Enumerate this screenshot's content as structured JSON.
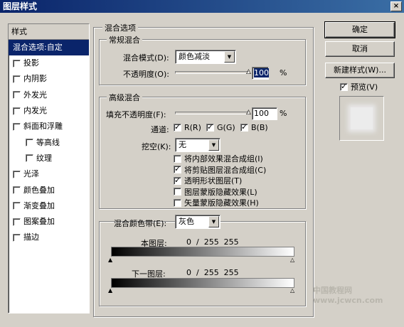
{
  "window": {
    "title": "图层样式",
    "close_glyph": "×"
  },
  "styles_panel": {
    "header": "样式",
    "items": [
      {
        "label": "混合选项:自定",
        "checkbox": false,
        "selected": true,
        "indent": false
      },
      {
        "label": "投影",
        "checkbox": true,
        "checked": false,
        "indent": false
      },
      {
        "label": "内阴影",
        "checkbox": true,
        "checked": false,
        "indent": false
      },
      {
        "label": "外发光",
        "checkbox": true,
        "checked": false,
        "indent": false
      },
      {
        "label": "内发光",
        "checkbox": true,
        "checked": false,
        "indent": false
      },
      {
        "label": "斜面和浮雕",
        "checkbox": true,
        "checked": false,
        "indent": false
      },
      {
        "label": "等高线",
        "checkbox": true,
        "checked": false,
        "indent": true
      },
      {
        "label": "纹理",
        "checkbox": true,
        "checked": false,
        "indent": true
      },
      {
        "label": "光泽",
        "checkbox": true,
        "checked": false,
        "indent": false
      },
      {
        "label": "颜色叠加",
        "checkbox": true,
        "checked": false,
        "indent": false
      },
      {
        "label": "渐变叠加",
        "checkbox": true,
        "checked": false,
        "indent": false
      },
      {
        "label": "图案叠加",
        "checkbox": true,
        "checked": false,
        "indent": false
      },
      {
        "label": "描边",
        "checkbox": true,
        "checked": false,
        "indent": false
      }
    ]
  },
  "blend_options": {
    "title": "混合选项",
    "general": {
      "title": "常规混合",
      "mode_label": "混合模式(D):",
      "mode_value": "颜色减淡",
      "opacity_label": "不透明度(O):",
      "opacity_value": "100",
      "opacity_percent": 100,
      "unit": "%"
    },
    "advanced": {
      "title": "高级混合",
      "fill_label": "填充不透明度(F):",
      "fill_value": "100",
      "fill_percent": 100,
      "unit": "%",
      "channels_label": "通道:",
      "channel_r": "R(R)",
      "channel_g": "G(G)",
      "channel_b": "B(B)",
      "knockout_label": "挖空(K):",
      "knockout_value": "无",
      "options": [
        {
          "label": "将内部效果混合成组(I)",
          "checked": false
        },
        {
          "label": "将剪贴图层混合成组(C)",
          "checked": true
        },
        {
          "label": "透明形状图层(T)",
          "checked": true
        },
        {
          "label": "图层蒙版隐藏效果(L)",
          "checked": false
        },
        {
          "label": "矢量蒙版隐藏效果(H)",
          "checked": false
        }
      ]
    },
    "blend_if": {
      "label": "混合颜色带(E):",
      "value": "灰色",
      "this_layer_label": "本图层:",
      "this_layer_values": "0  /  255  255",
      "underlying_label": "下一图层:",
      "underlying_values": "0  /  255  255"
    }
  },
  "buttons": {
    "ok": "确定",
    "cancel": "取消",
    "new_style": "新建样式(W)...",
    "preview_label": "预览(V)",
    "preview_checked": true
  },
  "watermark": "中国教程网  www.jcwcn.com"
}
